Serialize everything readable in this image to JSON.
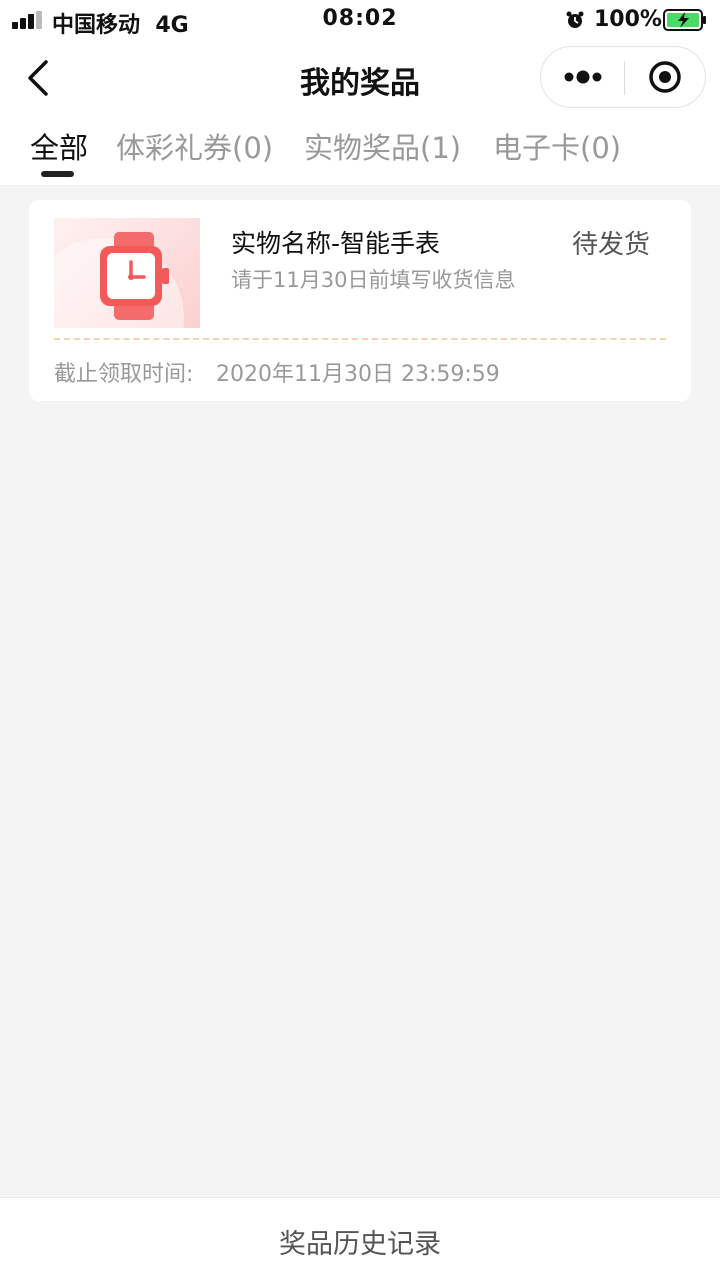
{
  "status_bar": {
    "carrier": "中国移动",
    "network": "4G",
    "time": "08:02",
    "battery_percent": "100%"
  },
  "nav": {
    "title": "我的奖品",
    "back_icon": "chevron-left-icon",
    "more_icon": "more-dots-icon",
    "close_icon": "target-close-icon"
  },
  "tabs": [
    {
      "label": "全部",
      "active": true
    },
    {
      "label": "体彩礼券(0)",
      "active": false
    },
    {
      "label": "实物奖品(1)",
      "active": false
    },
    {
      "label": "电子卡(0)",
      "active": false
    }
  ],
  "prizes": [
    {
      "name": "实物名称-智能手表",
      "status": "待发货",
      "hint": "请于11月30日前填写收货信息",
      "deadline_label": "截止领取时间:",
      "deadline_value": "2020年11月30日 23:59:59",
      "icon": "smartwatch-icon"
    }
  ],
  "footer": {
    "history_label": "奖品历史记录"
  },
  "colors": {
    "accent_red": "#f25a5a",
    "divider_gold": "#f2d4a8",
    "background": "#f4f4f4"
  }
}
